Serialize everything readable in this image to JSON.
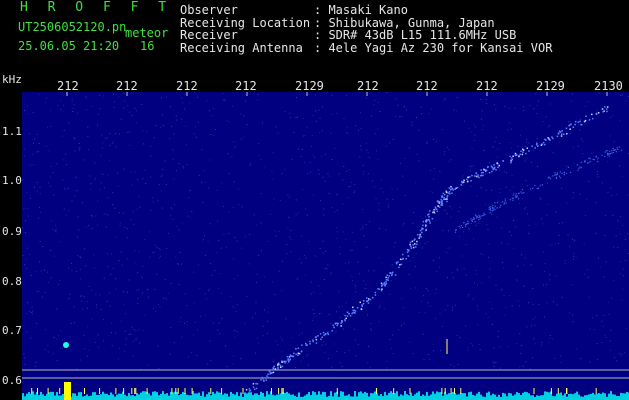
{
  "header": {
    "title": "H R O F F T",
    "filename": "UT2506052120.pn",
    "meteor_label": "meteor",
    "datetime": "25.06.05 21:20",
    "count": "16"
  },
  "info": [
    {
      "key": "Observer",
      "value": ": Masaki Kano"
    },
    {
      "key": "Receiving Location",
      "value": ": Shibukawa, Gunma, Japan"
    },
    {
      "key": "Receiver",
      "value": ": SDR# 43dB L15 111.6MHz USB"
    },
    {
      "key": "Receiving Antenna",
      "value": ": 4ele Yagi Az 230 for Kansai VOR"
    }
  ],
  "axes": {
    "y_unit": "kHz",
    "x_ticks": [
      "212",
      "212",
      "212",
      "212",
      "2129",
      "212",
      "212",
      "212",
      "2129",
      "2130"
    ],
    "y_ticks": [
      "1.1",
      "1.0",
      "0.9",
      "0.8",
      "0.7",
      "0.6"
    ]
  },
  "colors": {
    "header_text": "#3fe03f",
    "info_text": "#e6e6e6",
    "background": "#000080",
    "trace": "#5a7fff",
    "trace_bright": "#c8d8ff",
    "baseline": "#00d0e0",
    "burst": "#ffff00"
  }
}
